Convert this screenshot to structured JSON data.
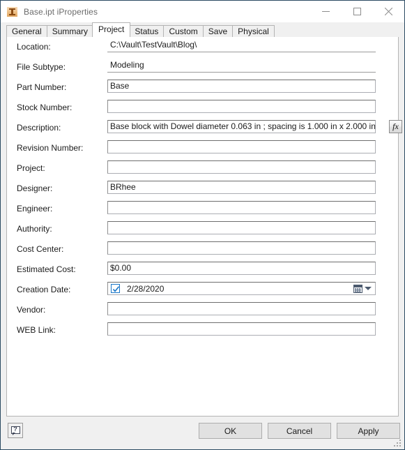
{
  "window": {
    "title": "Base.ipt iProperties",
    "icon": "inventor-part-icon",
    "controls": {
      "minimize": "minimize-icon",
      "maximize": "maximize-icon",
      "close": "close-icon"
    }
  },
  "tabs": [
    {
      "label": "General",
      "selected": false
    },
    {
      "label": "Summary",
      "selected": false
    },
    {
      "label": "Project",
      "selected": true
    },
    {
      "label": "Status",
      "selected": false
    },
    {
      "label": "Custom",
      "selected": false
    },
    {
      "label": "Save",
      "selected": false
    },
    {
      "label": "Physical",
      "selected": false
    }
  ],
  "fields": [
    {
      "label": "Location:",
      "value": "C:\\Vault\\TestVault\\Blog\\",
      "readonly": true
    },
    {
      "label": "File Subtype:",
      "value": "Modeling",
      "readonly": true
    },
    {
      "label": "Part Number:",
      "value": "Base",
      "readonly": false
    },
    {
      "label": "Stock Number:",
      "value": "",
      "readonly": false
    },
    {
      "label": "Description:",
      "value": "Base block with Dowel diameter 0.063 in ; spacing is 1.000 in x 2.000 in",
      "readonly": false
    },
    {
      "label": "Revision Number:",
      "value": "",
      "readonly": false
    },
    {
      "label": "Project:",
      "value": "",
      "readonly": false
    },
    {
      "label": "Designer:",
      "value": "BRhee",
      "readonly": false
    },
    {
      "label": "Engineer:",
      "value": "",
      "readonly": false
    },
    {
      "label": "Authority:",
      "value": "",
      "readonly": false
    },
    {
      "label": "Cost Center:",
      "value": "",
      "readonly": false
    },
    {
      "label": "Estimated Cost:",
      "value": "$0.00",
      "readonly": false
    },
    {
      "label": "Vendor:",
      "value": "",
      "readonly": false
    },
    {
      "label": "WEB Link:",
      "value": "",
      "readonly": false
    }
  ],
  "description_fx": {
    "label": "fx",
    "sub": "x",
    "name": "fx-button"
  },
  "creation_date": {
    "label": "Creation Date:",
    "checked": true,
    "value": "2/28/2020",
    "calendar_icon": "calendar-icon",
    "dropdown_icon": "chevron-down-icon"
  },
  "footer": {
    "help": "?",
    "ok": "OK",
    "cancel": "Cancel",
    "apply": "Apply"
  },
  "colors": {
    "window_border": "#2b4a62",
    "dialog_bg": "#f0f0f0",
    "panel_bg": "#ffffff",
    "accent_check": "#1976c8",
    "icon_orange": "#e2a863"
  }
}
